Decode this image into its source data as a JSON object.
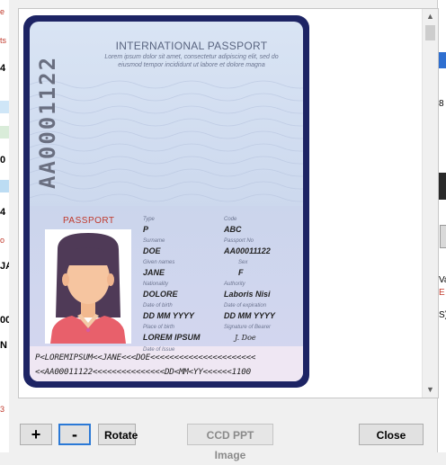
{
  "background_left": {
    "fragments": [
      "e",
      "ts",
      "4",
      "0",
      "4",
      "o",
      "JAI",
      "00",
      "N",
      "3"
    ]
  },
  "background_right": {
    "fragments": [
      "8",
      "Va",
      "E",
      "S)"
    ]
  },
  "viewer": {
    "passport": {
      "doc_title": "INTERNATIONAL PASSPORT",
      "doc_sub_1": "Lorem ipsum dolor sit amet, consectetur adipiscing elit, sed do",
      "doc_sub_2": "eiusmod tempor incididunt ut labore et dolore magna",
      "vertical_number": "AA0001122",
      "page_label": "PASSPORT",
      "fields": {
        "type_label": "Type",
        "type_value": "P",
        "code_label": "Code",
        "code_value": "ABC",
        "surname_label": "Surname",
        "surname_value": "DOE",
        "passport_no_label": "Passport No",
        "passport_no_value": "AA00011122",
        "given_names_label": "Given names",
        "given_names_value": "JANE",
        "sex_label": "Sex",
        "sex_value": "F",
        "nationality_label": "Nationality",
        "nationality_value": "DOLORE",
        "authority_label": "Authority",
        "authority_value": "Laboris Nisi",
        "dob_label": "Date of birth",
        "dob_value": "DD MM YYYY",
        "doe_label": "Date of expiration",
        "doe_value": "DD MM YYYY",
        "pob_label": "Place of birth",
        "pob_value": "LOREM IPSUM",
        "signature_label": "Signature of Bearer",
        "signature_value": "J. Doe",
        "doi_label": "Date of Issue"
      },
      "mrz_line_1": "P<LOREMIPSUM<<JANE<<<DOE<<<<<<<<<<<<<<<<<<<<<<",
      "mrz_line_2": "<<AA00011122<<<<<<<<<<<<<<<DD<MM<YY<<<<<<1100"
    }
  },
  "buttons": {
    "zoom_in": "+",
    "zoom_out": "-",
    "rotate": "Rotate",
    "ccd_ppt_image": "CCD PPT Image",
    "close": "Close"
  },
  "icons": {
    "scroll_up": "scroll-up-arrow-icon",
    "scroll_down": "scroll-down-arrow-icon"
  }
}
